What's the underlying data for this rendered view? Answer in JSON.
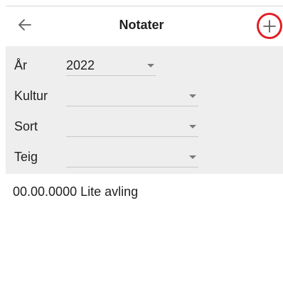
{
  "appbar": {
    "title": "Notater",
    "back_icon": "arrow-left-icon",
    "add_icon": "plus-icon",
    "highlight_color": "#e01f26"
  },
  "filters": [
    {
      "label": "År",
      "value": "2022"
    },
    {
      "label": "Kultur",
      "value": ""
    },
    {
      "label": "Sort",
      "value": ""
    },
    {
      "label": "Teig",
      "value": ""
    }
  ],
  "notes": [
    {
      "text": "00.00.0000 Lite avling"
    }
  ],
  "colors": {
    "filter_background": "#eeeeee",
    "text": "#1f1f1f"
  }
}
